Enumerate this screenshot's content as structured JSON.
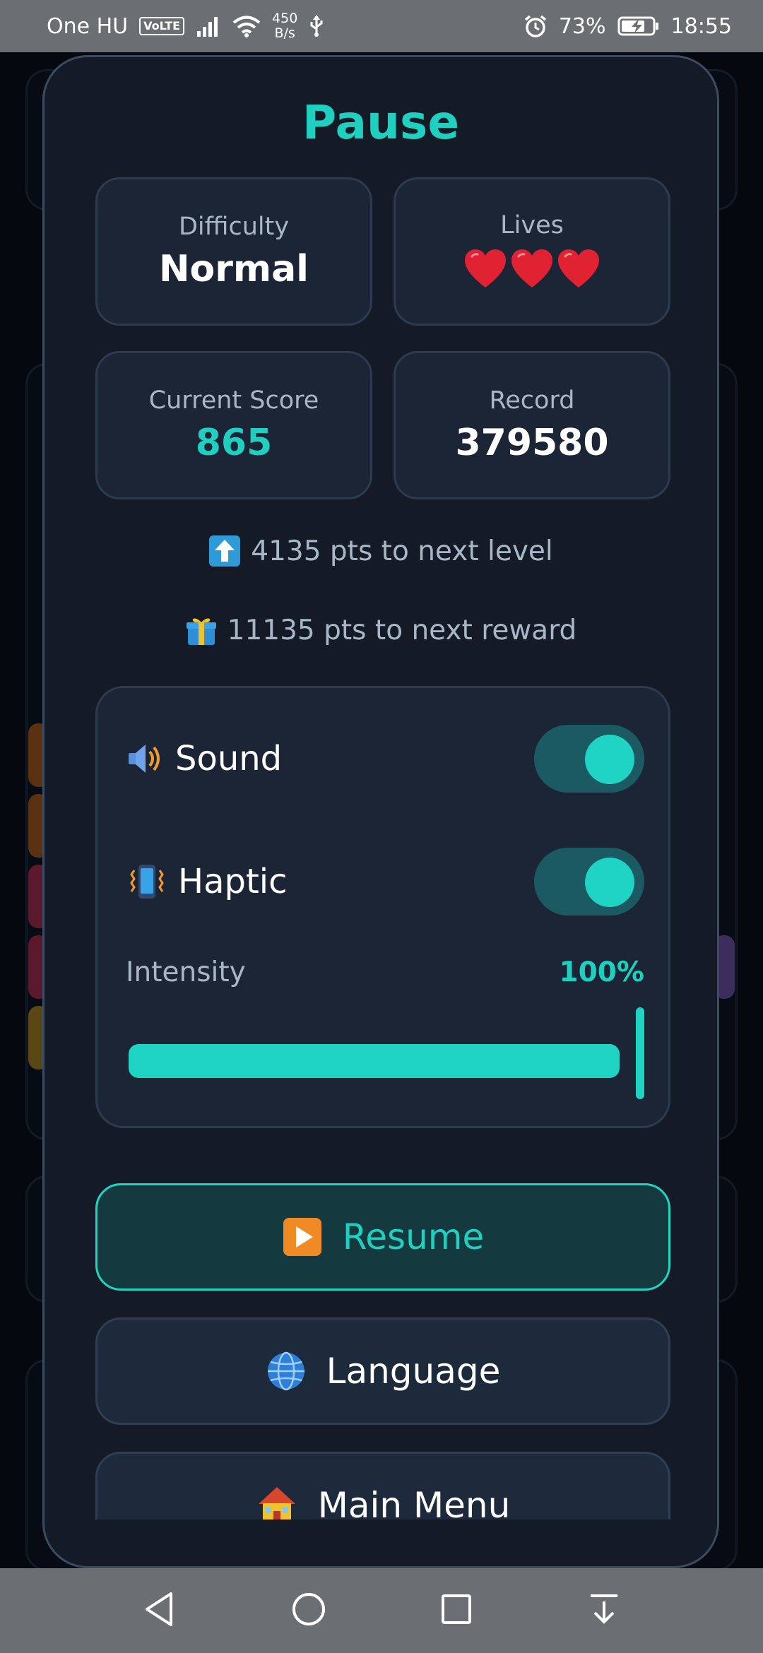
{
  "status_bar": {
    "carrier": "One HU",
    "volte": "VoLTE",
    "speed_value": "450",
    "speed_unit": "B/s",
    "battery": "73%",
    "time": "18:55"
  },
  "modal": {
    "title": "Pause",
    "stats": {
      "difficulty_label": "Difficulty",
      "difficulty_value": "Normal",
      "lives_label": "Lives",
      "lives_count": 3,
      "score_label": "Current Score",
      "score_value": "865",
      "record_label": "Record",
      "record_value": "379580"
    },
    "next_level_text": "4135 pts to next level",
    "next_reward_text": "11135 pts to next reward",
    "settings": {
      "sound_label": "Sound",
      "sound_on": true,
      "haptic_label": "Haptic",
      "haptic_on": true,
      "intensity_label": "Intensity",
      "intensity_value": "100%",
      "intensity_fraction": 1.0
    },
    "buttons": {
      "resume": "Resume",
      "language": "Language",
      "main_menu": "Main Menu"
    }
  },
  "colors": {
    "accent": "#1fcfbf",
    "panel": "#1b2535",
    "modal_bg": "#141b27"
  }
}
